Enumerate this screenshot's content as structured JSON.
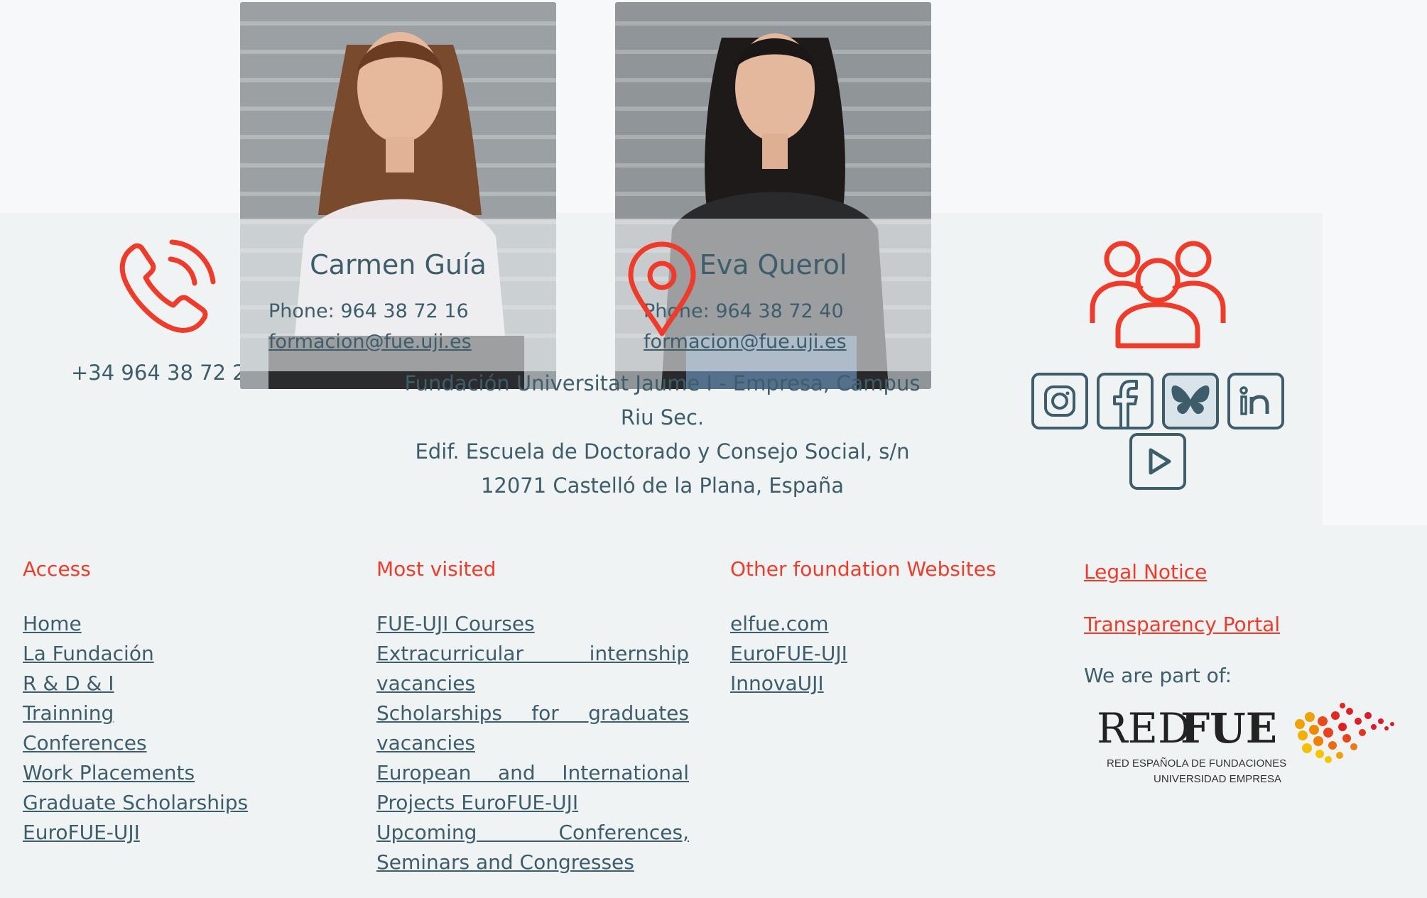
{
  "contacts": [
    {
      "name": "Carmen Guía",
      "phone": "Phone: 964 38 72 16",
      "email": "formacion@fue.uji.es"
    },
    {
      "name": "Eva Querol",
      "phone": "Phone: 964 38 72 40",
      "email": "formacion@fue.uji.es"
    }
  ],
  "contact": {
    "phone": "+34 964 38 72 22",
    "address_lines": [
      "Fundación Universitat Jaume I - Empresa, Campus",
      "Riu Sec.",
      "Edif. Escuela de Doctorado y Consejo Social, s/n",
      "12071 Castelló de la Plana, España"
    ]
  },
  "social": [
    "instagram-icon",
    "facebook-icon",
    "bluesky-icon",
    "linkedin-icon",
    "youtube-icon"
  ],
  "footer": {
    "access": {
      "title": "Access",
      "links": [
        "Home",
        "La Fundación",
        "R & D & I",
        "Trainning",
        "Conferences",
        "Work Placements",
        "Graduate Scholarships",
        "EuroFUE-UJI"
      ]
    },
    "most_visited": {
      "title": "Most visited",
      "links": [
        "FUE-UJI Courses",
        "Extracurricular internship vacancies",
        "Scholarships for graduates vacancies",
        "European and International Projects EuroFUE-UJI",
        "Upcoming Conferences, Seminars and Congresses"
      ]
    },
    "other": {
      "title": "Other foundation Websites",
      "links": [
        "elfue.com",
        "EuroFUE-UJI",
        "InnovaUJI"
      ]
    },
    "legal": {
      "legal_notice": "Legal Notice",
      "transparency": "Transparency Portal",
      "part_of": "We are part of:"
    }
  },
  "redfue": {
    "brand_a": "RED",
    "brand_b": "FUE",
    "sub1": "RED ESPAÑOLA DE FUNDACIONES",
    "sub2": "UNIVERSIDAD EMPRESA"
  },
  "colors": {
    "accent": "#f03a2a",
    "text": "#3d5d6b",
    "background": "#f0f3f4"
  }
}
